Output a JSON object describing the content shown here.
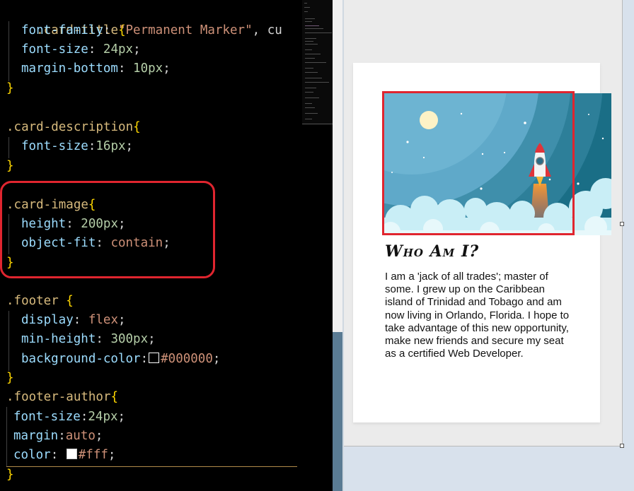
{
  "editor": {
    "lines": [
      {
        "key": "l1",
        "text": ".card-title{"
      },
      {
        "key": "l2",
        "prop": "font-family",
        "value": "\"Permanent Marker\"",
        "tail": ", cu"
      },
      {
        "key": "l3",
        "prop": "font-size",
        "value": "24px"
      },
      {
        "key": "l4",
        "prop": "margin-bottom",
        "value": "10px"
      },
      {
        "key": "l5",
        "text": "}"
      },
      {
        "key": "l6",
        "text": ".card-description{"
      },
      {
        "key": "l7",
        "prop": "font-size",
        "value": "16px"
      },
      {
        "key": "l8",
        "text": "}"
      },
      {
        "key": "l9",
        "text": ".card-image{"
      },
      {
        "key": "l10",
        "prop": "height",
        "value": "200px"
      },
      {
        "key": "l11",
        "prop": "object-fit",
        "value": "contain"
      },
      {
        "key": "l12",
        "text": "}"
      },
      {
        "key": "l13",
        "text": ".footer {"
      },
      {
        "key": "l14",
        "prop": "display",
        "value": "flex"
      },
      {
        "key": "l15",
        "prop": "min-height",
        "value": "300px"
      },
      {
        "key": "l16",
        "prop": "background-color",
        "value": "#000000"
      },
      {
        "key": "l17",
        "text": "}"
      },
      {
        "key": "l18",
        "text": ".footer-author{"
      },
      {
        "key": "l19",
        "prop": "font-size",
        "value": "24px"
      },
      {
        "key": "l20",
        "prop": "margin",
        "value": "auto"
      },
      {
        "key": "l21",
        "prop": "color",
        "value": "#fff"
      },
      {
        "key": "l22",
        "text": "}"
      }
    ],
    "colors": {
      "background": "#000000",
      "selector": "#d7ba7d",
      "brace": "#ffd700",
      "property": "#9cdcfe",
      "string": "#ce9178",
      "number": "#b5cea8",
      "highlight": "#e0252f"
    }
  },
  "preview": {
    "card": {
      "title": "Who Am I?",
      "description": "I am a 'jack of all trades'; master of some. I grew up on the Caribbean island of Trinidad and Tobago and am now living in Orlando, Florida. I hope to take advantage of this new opportunity, make new friends and secure my seat as a certified Web Developer.",
      "image_icon": "rocket-space-illustration"
    },
    "colors": {
      "frame": "#ebebeb",
      "card": "#ffffff",
      "sky_dark": "#1a6e86",
      "sky_light": "#5fa9c9",
      "cloud": "#c9eef6",
      "rocket_flame": "#e9533b"
    }
  }
}
